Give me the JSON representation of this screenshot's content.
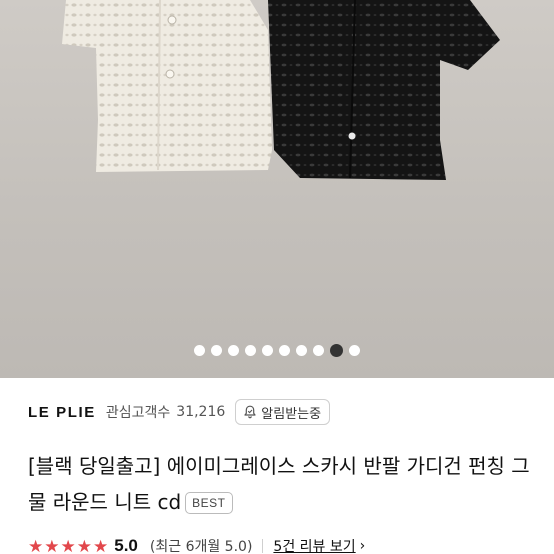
{
  "gallery": {
    "image_alt": "product-photo-cardigans",
    "slide_count": 10,
    "active_index": 8
  },
  "brand": {
    "name": "LE PLIE",
    "favorites_label": "관심고객수",
    "favorites_count": "31,216",
    "notify_label": "알림받는중"
  },
  "product": {
    "title": "[블랙 당일출고] 에이미그레이스 스카시 반팔 가디건 펀칭 그물 라운드 니트 cd",
    "badge": "BEST"
  },
  "rating": {
    "stars": 5,
    "score": "5.0",
    "recent_label": "(최근 6개월 5.0)",
    "reviews_link": "5건 리뷰 보기",
    "star_color": "#e2474b"
  },
  "colors": {
    "active_dot": "#333333",
    "inactive_dot": "#ffffff"
  },
  "icons": [
    "bell-icon",
    "star-icon",
    "chevron-right-icon"
  ]
}
